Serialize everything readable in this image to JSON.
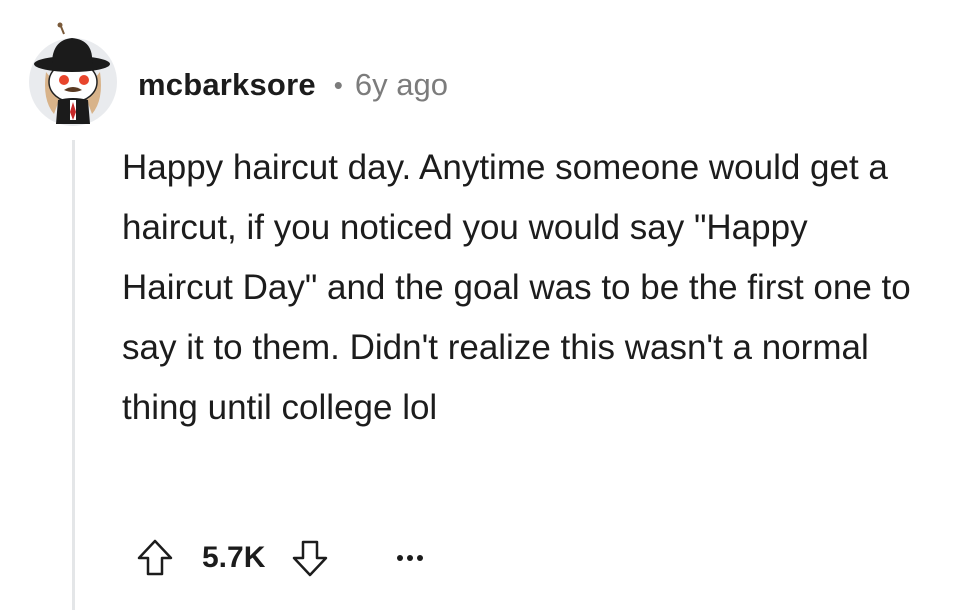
{
  "comment": {
    "avatar": {
      "icon": "snoo-avatar-icon",
      "description_name": "user-avatar"
    },
    "username": "mcbarksore",
    "separator": "•",
    "age": "6y ago",
    "body": "Happy haircut day. Anytime someone would get a haircut, if you noticed you would say \"Happy Haircut Day\" and the goal was to be the first one to say it to them. Didn't realize this wasn't a normal thing until college lol",
    "actions": {
      "upvote_icon": "arrow-up-icon",
      "score": "5.7K",
      "downvote_icon": "arrow-down-icon",
      "more_icon": "more-dots-icon"
    }
  },
  "colors": {
    "text": "#1c1c1c",
    "meta": "#7c7c7c",
    "thread_line": "#e4e6e8"
  }
}
